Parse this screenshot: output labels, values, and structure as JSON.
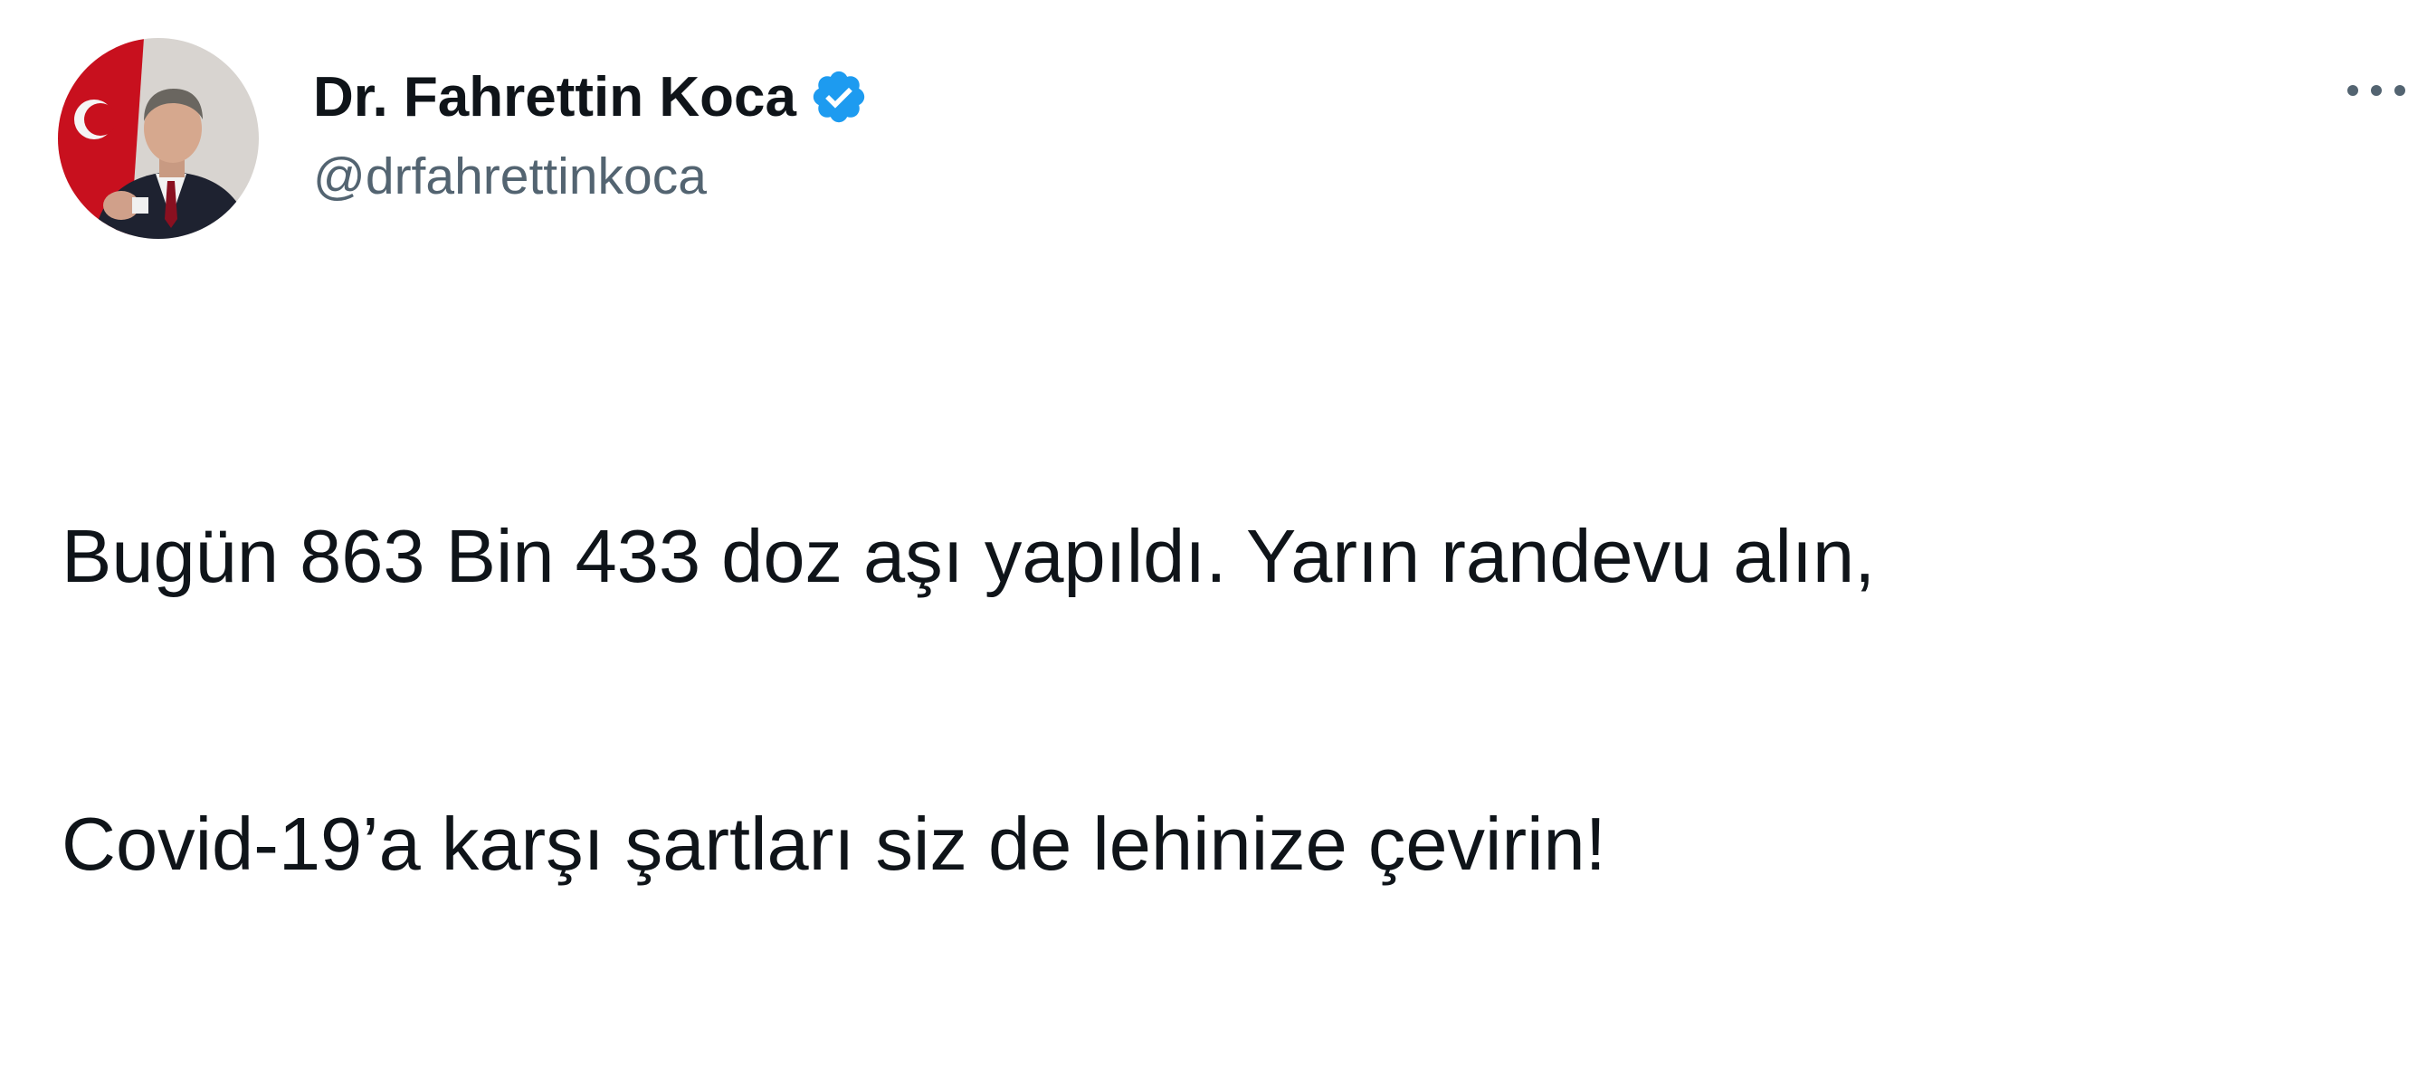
{
  "tweet": {
    "author": {
      "display_name": "Dr. Fahrettin Koca",
      "handle": "@drfahrettinkoca",
      "verified": true,
      "avatar_icon": "profile-photo"
    },
    "more_icon": "more-options-icon",
    "text_lines": [
      "Bugün 863 Bin 433 doz aşı yapıldı. Yarın randevu alın,",
      "Covid-19’a karşı şartları siz de lehinize çevirin!"
    ]
  },
  "colors": {
    "verified_badge": "#1d9bf0",
    "handle_text": "#536471",
    "primary_text": "#0f1419",
    "flag_red": "#e30a17"
  }
}
